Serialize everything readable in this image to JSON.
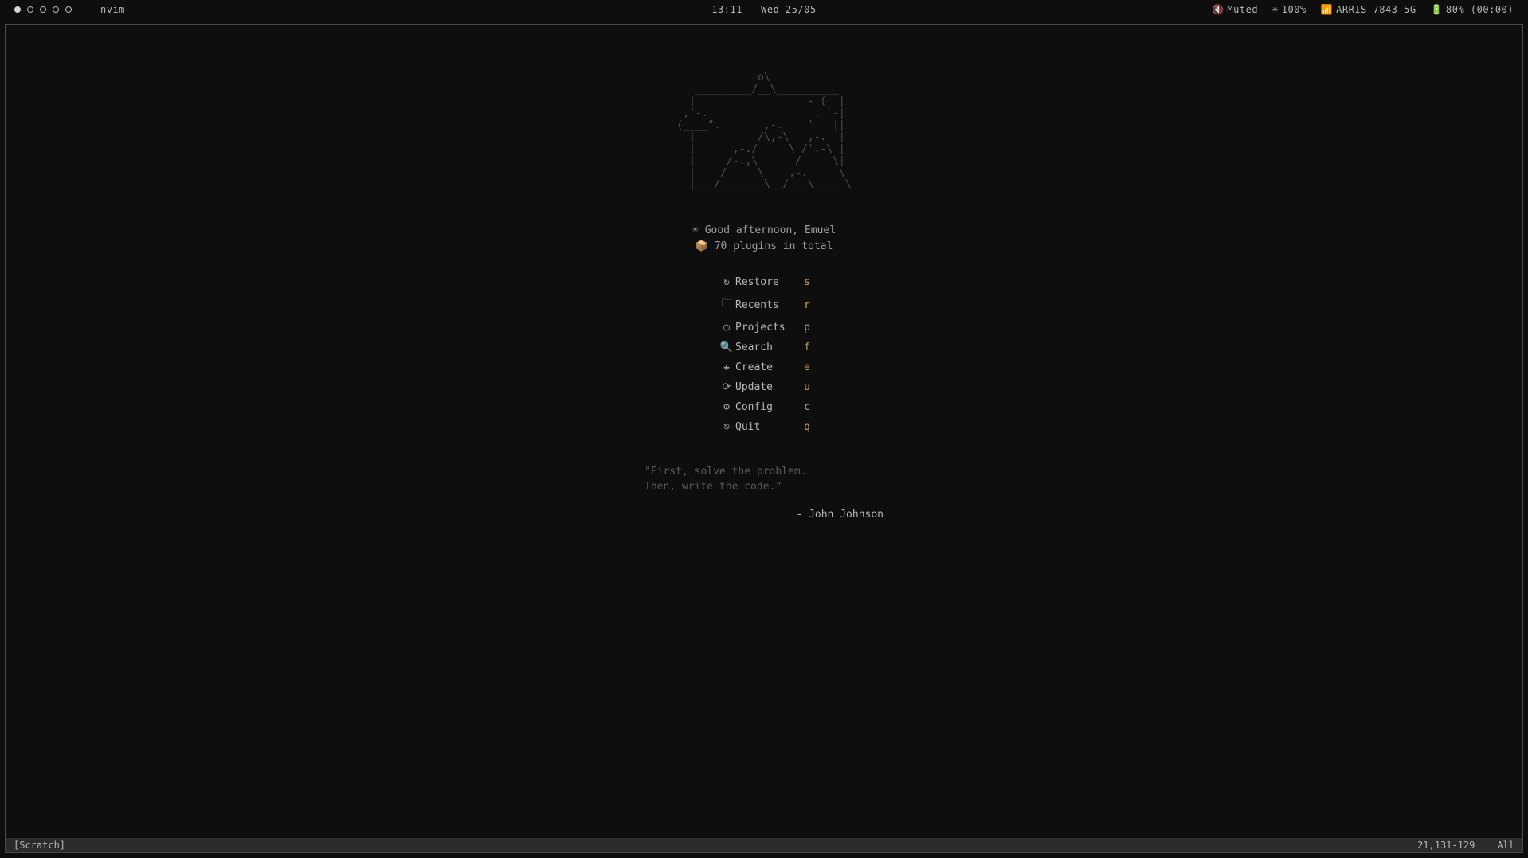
{
  "topbar": {
    "app_name": "nvim",
    "datetime": "13:11 - Wed 25/05",
    "audio": "Muted",
    "brightness": "100%",
    "wifi": "ARRIS-7843-5G",
    "battery": "80% (00:00)",
    "workspaces": {
      "count": 5,
      "active_index": 0
    }
  },
  "ascii_art": "             o\\\n   _________/__\\__________\n  |                  - (  |\n ,'-.                 . `-|\n(____\".       ,-.    '   ||\n  |          /\\,-\\   ,-.  |\n  |      ,-./     \\ /'.-\\ |\n  |     /-.,\\      /     \\|\n  |    /     \\    ,-.     \\\n  |___/_______\\__/___\\_____\\",
  "greeting": {
    "line1": "Good afternoon, Emuel",
    "line2": "70 plugins in total"
  },
  "menu": [
    {
      "icon": "↻",
      "label": "Restore",
      "key": "s"
    },
    {
      "icon": "🗀",
      "label": "Recents",
      "key": "r"
    },
    {
      "icon": "○",
      "label": "Projects",
      "key": "p"
    },
    {
      "icon": "🔍",
      "label": "Search",
      "key": "f"
    },
    {
      "icon": "✚",
      "label": "Create",
      "key": "e"
    },
    {
      "icon": "⟳",
      "label": "Update",
      "key": "u"
    },
    {
      "icon": "⚙",
      "label": "Config",
      "key": "c"
    },
    {
      "icon": "⎋",
      "label": "Quit",
      "key": "q"
    }
  ],
  "quote": {
    "text": "\"First, solve the problem.\nThen, write the code.\"",
    "author": "- John Johnson"
  },
  "statusline": {
    "left": "[Scratch]",
    "position": "21,131-129",
    "scroll": "All"
  }
}
